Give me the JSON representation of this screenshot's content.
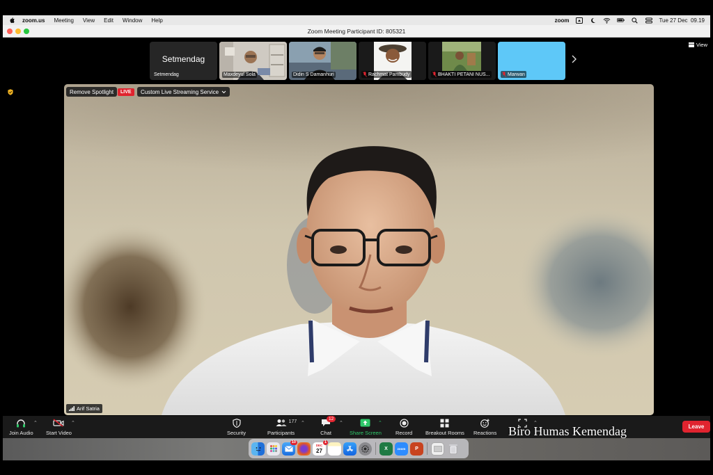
{
  "menubar": {
    "app_name": "zoom.us",
    "items": [
      "Meeting",
      "View",
      "Edit",
      "Window",
      "Help"
    ],
    "status_zoom": "zoom",
    "clock": "Tue 27 Dec  09.19"
  },
  "window": {
    "title": "Zoom Meeting Participant ID: 805321"
  },
  "view_button": "View",
  "thumbnails": [
    {
      "bigname": "Setmendag",
      "name": "Setmendag",
      "muted": false
    },
    {
      "name": "Maxdeyul Sola",
      "muted": false
    },
    {
      "name": "Didin S Damanhuri",
      "muted": false
    },
    {
      "name": "Rachmat Pambudy",
      "muted": true
    },
    {
      "name": "BHAKTI PETANI NUS...",
      "muted": true
    },
    {
      "name": "Marwan",
      "muted": true
    }
  ],
  "spotlight": {
    "remove_label": "Remove Spotlight",
    "live_label": "LIVE",
    "stream_label": "Custom Live Streaming Service",
    "speaker": "Arif Satria"
  },
  "toolbar": {
    "join_audio": "Join Audio",
    "start_video": "Start Video",
    "security": "Security",
    "participants": "Participants",
    "participants_count": "177",
    "chat": "Chat",
    "chat_badge": "12",
    "share_screen": "Share Screen",
    "record": "Record",
    "breakout_rooms": "Breakout Rooms",
    "reactions": "Reactions",
    "leave": "Leave"
  },
  "watermark": "Biro Humas Kemendag",
  "dock": {
    "calendar_day": "27",
    "calendar_month": "DEC",
    "mail_badge": "10",
    "calendar_badge": "1"
  },
  "colors": {
    "leave_red": "#e0242f",
    "share_green": "#2fc86a",
    "marwan_tile": "#5ec8f8"
  }
}
